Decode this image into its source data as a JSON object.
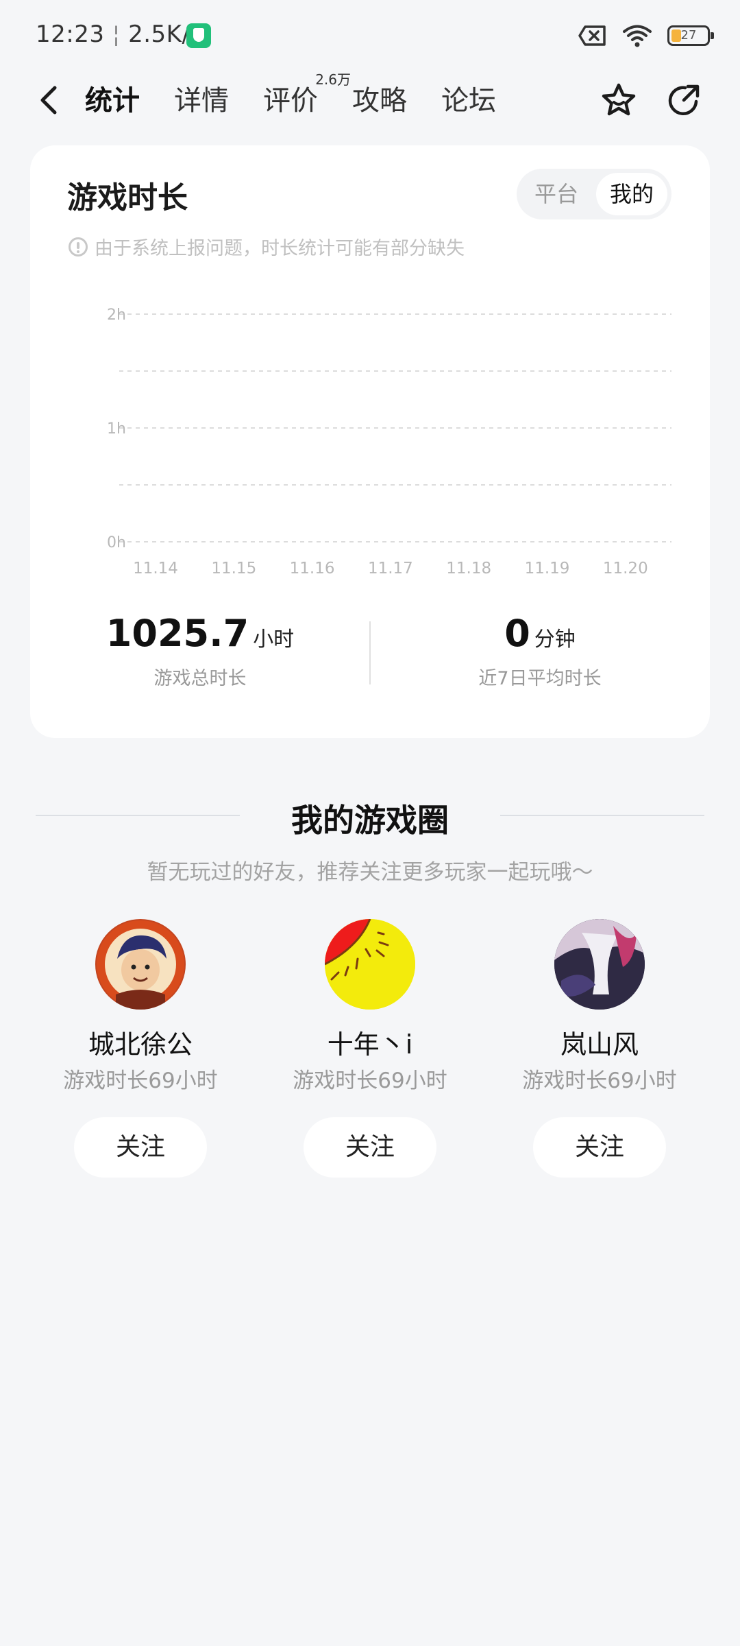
{
  "status_bar": {
    "time": "12:23",
    "speed": "2.5K/s",
    "battery_level": "27",
    "icons": [
      "shield-icon",
      "sim-off-icon",
      "wifi-icon",
      "battery-icon"
    ]
  },
  "nav": {
    "back_icon": "back-arrow-icon",
    "tabs": [
      {
        "label": "统计",
        "active": true
      },
      {
        "label": "详情",
        "active": false
      },
      {
        "label": "评价",
        "active": false,
        "sup": "2.6万"
      },
      {
        "label": "攻略",
        "active": false
      },
      {
        "label": "论坛",
        "active": false
      }
    ],
    "actions": [
      "star-icon",
      "share-icon"
    ]
  },
  "stats_card": {
    "title": "游戏时长",
    "toggle": {
      "left": "平台",
      "right": "我的",
      "selected": "我的"
    },
    "notice": "由于系统上报问题，时长统计可能有部分缺失",
    "total": {
      "value": "1025.7",
      "unit": "小时",
      "label": "游戏总时长"
    },
    "average": {
      "value": "0",
      "unit": "分钟",
      "label": "近7日平均时长"
    }
  },
  "chart_data": {
    "type": "bar",
    "categories": [
      "11.14",
      "11.15",
      "11.16",
      "11.17",
      "11.18",
      "11.19",
      "11.20"
    ],
    "values": [
      0,
      0,
      0,
      0,
      0,
      0,
      0
    ],
    "y_ticks": [
      "2h",
      "1h",
      "0h"
    ],
    "ylim": [
      0,
      2
    ],
    "title": "",
    "xlabel": "",
    "ylabel": "",
    "grid": true
  },
  "circle": {
    "title": "我的游戏圈",
    "subtitle": "暂无玩过的好友，推荐关注更多玩家一起玩哦～",
    "friends": [
      {
        "name": "城北徐公",
        "time": "游戏时长69小时",
        "follow": "关注"
      },
      {
        "name": "十年丶i",
        "time": "游戏时长69小时",
        "follow": "关注"
      },
      {
        "name": "岚山风",
        "time": "游戏时长69小时",
        "follow": "关注"
      }
    ]
  }
}
